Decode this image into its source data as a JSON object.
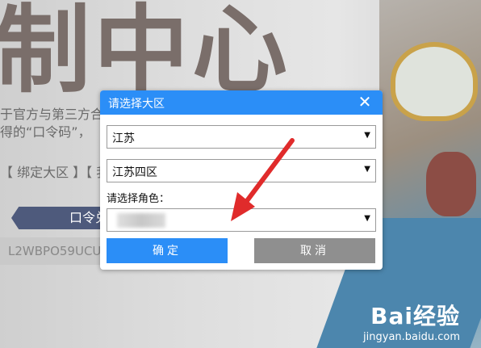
{
  "background": {
    "heading": "制中心",
    "line1": "于官方与第三方合作",
    "line2": "得的“口令码”，",
    "line3": "【 绑定大区 】【 我",
    "tab_label": "口令兑",
    "code_text": "L2WBPO59UCU"
  },
  "watermark": {
    "logo": "Bai经验",
    "url": "jingyan.baidu.com"
  },
  "dialog": {
    "title": "请选择大区",
    "close_symbol": "✕",
    "province_select": {
      "value": "江苏",
      "arrow": "▼"
    },
    "server_select": {
      "value": "江苏四区",
      "arrow": "▼"
    },
    "role_label": "请选择角色：",
    "role_select": {
      "value": "",
      "arrow": "▼"
    },
    "confirm_label": "确定",
    "cancel_label": "取消"
  },
  "colors": {
    "primary": "#2b8ef7",
    "cancel": "#8f8f8f",
    "arrow": "#e02b2b"
  }
}
